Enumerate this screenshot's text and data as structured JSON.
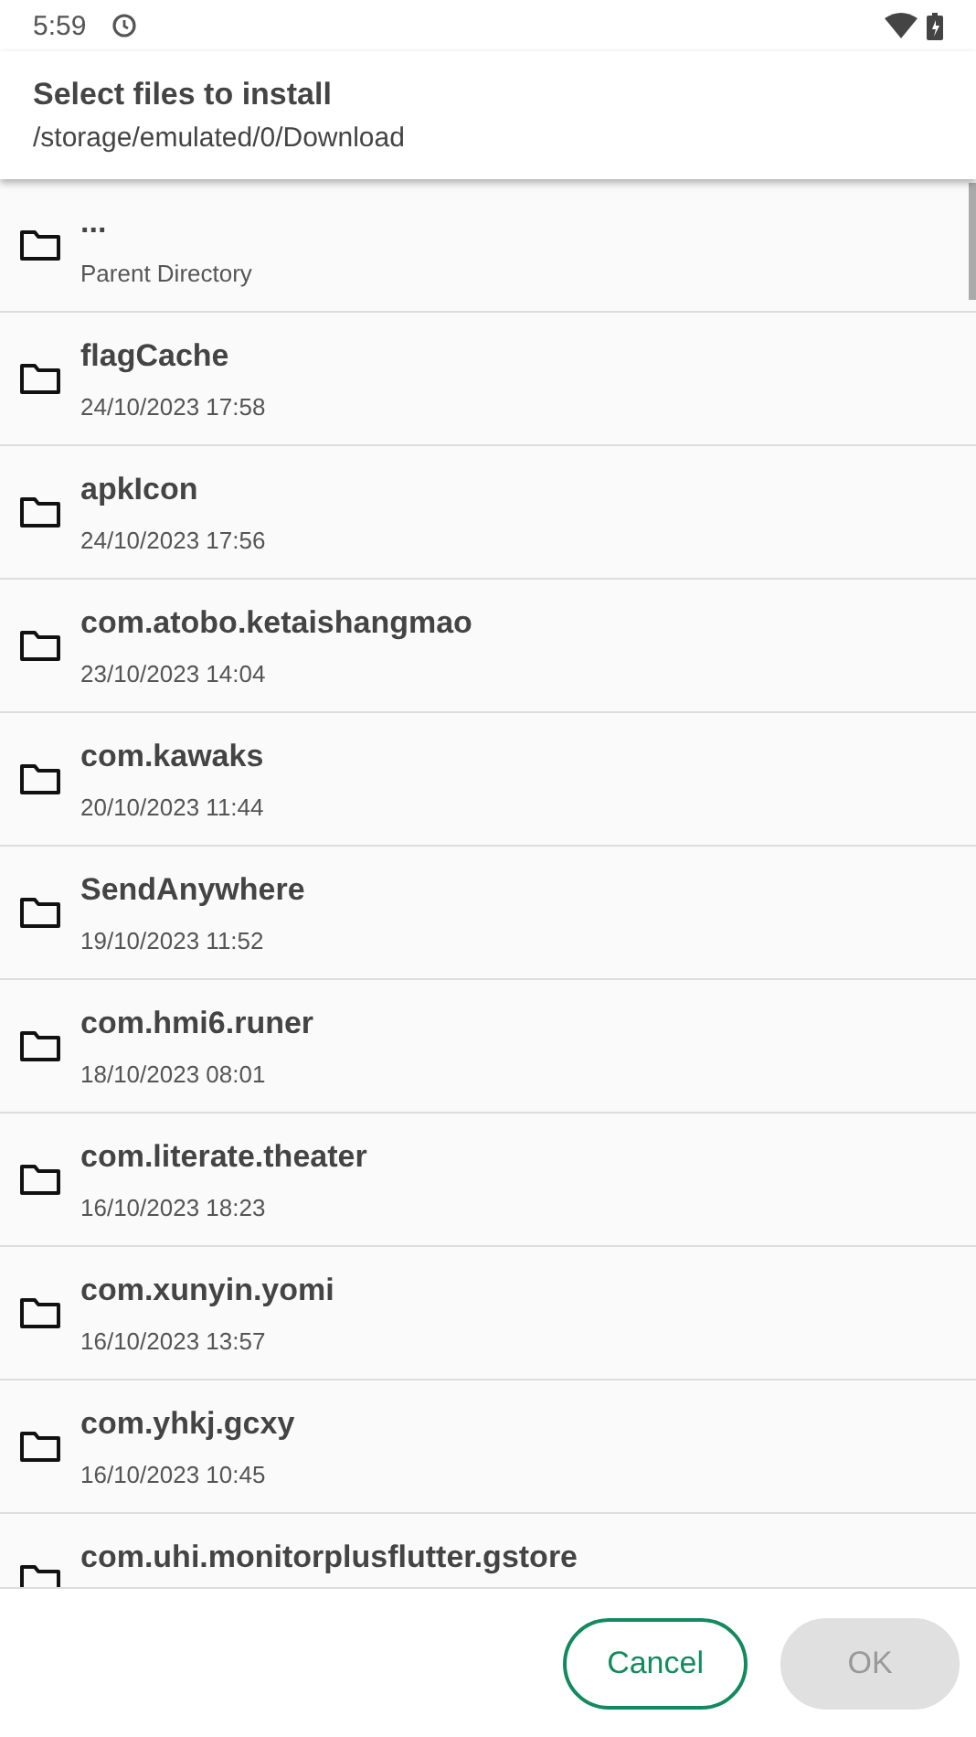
{
  "status_bar": {
    "time": "5:59"
  },
  "dialog": {
    "title": "Select files to install",
    "path": "/storage/emulated/0/Download"
  },
  "files": [
    {
      "name": "...",
      "detail": "Parent Directory"
    },
    {
      "name": "flagCache",
      "detail": "24/10/2023 17:58"
    },
    {
      "name": "apkIcon",
      "detail": "24/10/2023 17:56"
    },
    {
      "name": "com.atobo.ketaishangmao",
      "detail": "23/10/2023 14:04"
    },
    {
      "name": "com.kawaks",
      "detail": "20/10/2023 11:44"
    },
    {
      "name": "SendAnywhere",
      "detail": "19/10/2023 11:52"
    },
    {
      "name": "com.hmi6.runer",
      "detail": "18/10/2023 08:01"
    },
    {
      "name": "com.literate.theater",
      "detail": "16/10/2023 18:23"
    },
    {
      "name": "com.xunyin.yomi",
      "detail": "16/10/2023 13:57"
    },
    {
      "name": "com.yhkj.gcxy",
      "detail": "16/10/2023 10:45"
    },
    {
      "name": "com.uhi.monitorplusflutter.gstore"
    }
  ],
  "buttons": [
    {
      "label": "Cancel",
      "disabled": false
    },
    {
      "label": "OK",
      "disabled": true
    }
  ]
}
